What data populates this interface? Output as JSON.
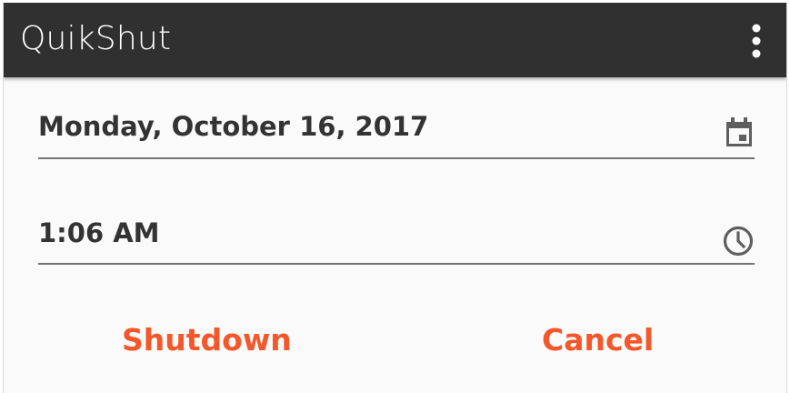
{
  "app": {
    "title": "QuikShut"
  },
  "icons": {
    "menu": "more-vertical-icon",
    "date": "calendar-icon",
    "time": "clock-icon"
  },
  "form": {
    "date_value": "Monday, October 16, 2017",
    "time_value": "1:06 AM"
  },
  "actions": {
    "shutdown_label": "Shutdown",
    "cancel_label": "Cancel"
  },
  "colors": {
    "appbar": "#303030",
    "background": "#fafafa",
    "accent": "#f4572a",
    "text": "#333333",
    "underline": "#757575",
    "icon": "#5f5f5f"
  }
}
